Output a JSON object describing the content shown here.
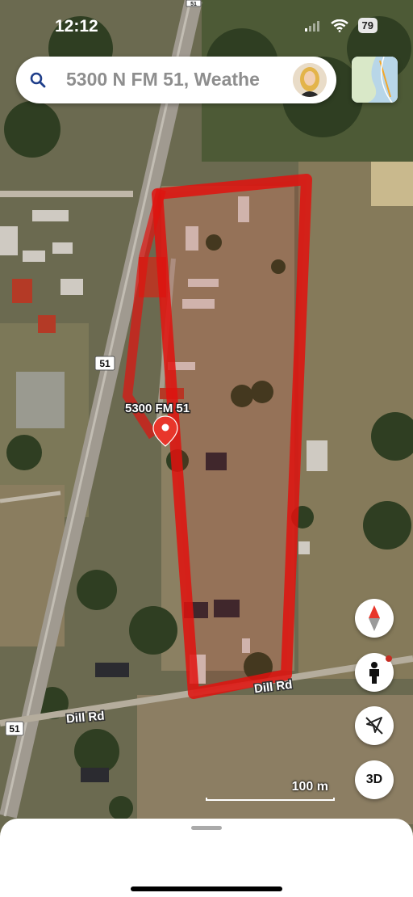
{
  "status_bar": {
    "time": "12:12",
    "battery": "79"
  },
  "search": {
    "text": "5300 N FM 51, Weathe"
  },
  "map": {
    "pin_label": "5300 FM 51",
    "road_labels": {
      "dill_rd_east": "Dill Rd",
      "dill_rd_west": "Dill Rd"
    },
    "route_shields": [
      "51",
      "51",
      "51"
    ],
    "scale_label": "100 m",
    "boundary_color": "#e0120e"
  },
  "controls": {
    "three_d_label": "3D"
  },
  "icons": [
    "search-icon",
    "map-layers-icon",
    "compass-icon",
    "street-view-icon",
    "location-arrow-icon",
    "signal-icon",
    "wifi-icon"
  ]
}
